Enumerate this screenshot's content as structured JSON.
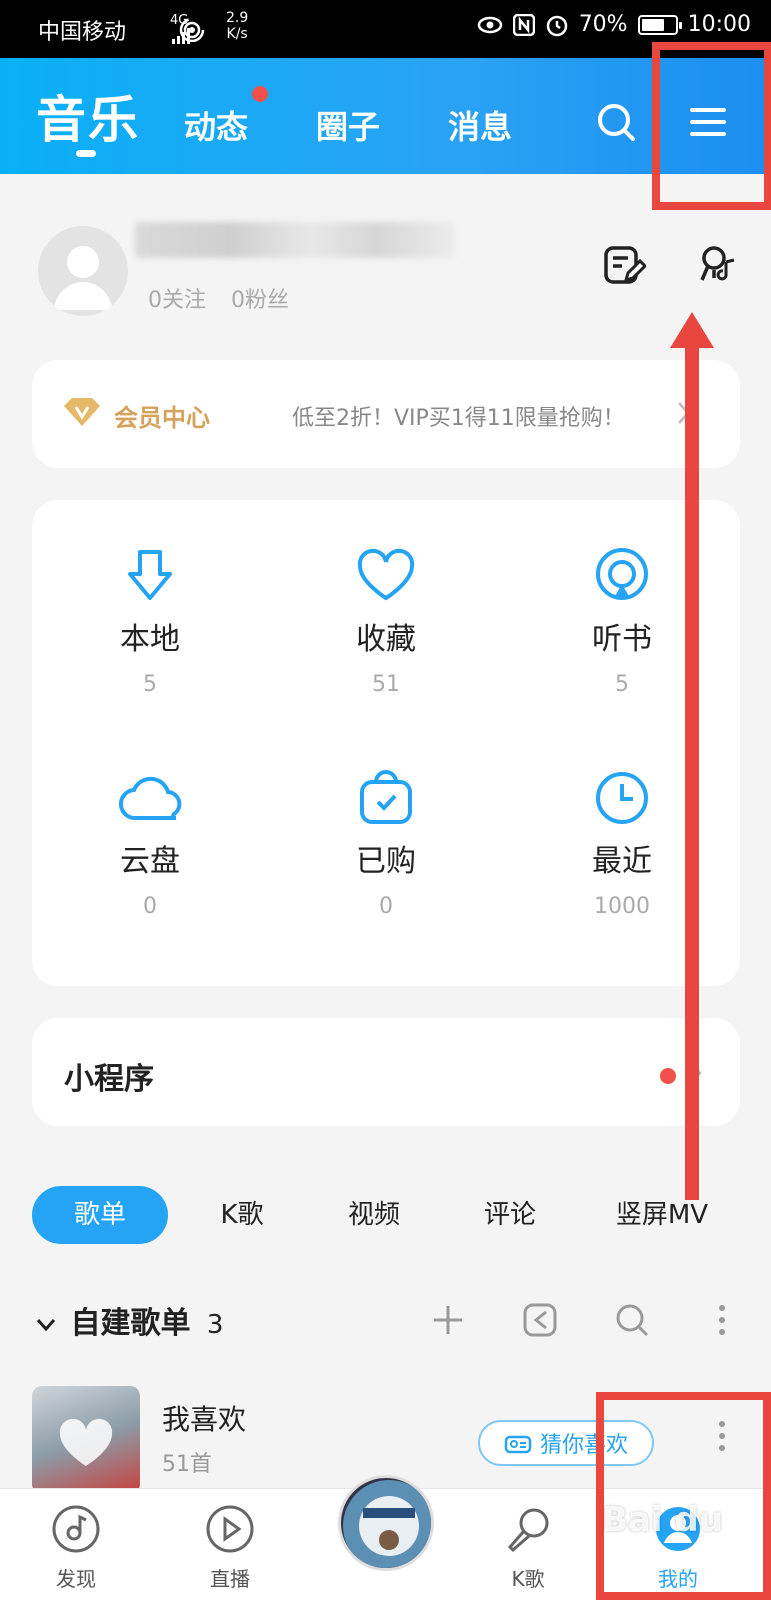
{
  "status_bar": {
    "carrier": "中国移动",
    "network": "4G",
    "speed_value": "2.9",
    "speed_unit": "K/s",
    "battery": "70%",
    "time": "10:00",
    "battery_level": 0.7
  },
  "header": {
    "title": "音乐",
    "tabs": [
      "动态",
      "圈子",
      "消息"
    ],
    "search_icon": "search-icon",
    "menu_icon": "menu-icon"
  },
  "profile": {
    "following_count": "0关注",
    "fans_count": "0粉丝"
  },
  "vip": {
    "title": "会员中心",
    "promo": "低至2折！VIP买1得11限量抢购！"
  },
  "grid": [
    {
      "label": "本地",
      "count": "5",
      "icon": "download-icon"
    },
    {
      "label": "收藏",
      "count": "51",
      "icon": "heart-icon"
    },
    {
      "label": "听书",
      "count": "5",
      "icon": "audiobook-icon"
    },
    {
      "label": "云盘",
      "count": "0",
      "icon": "cloud-icon"
    },
    {
      "label": "已购",
      "count": "0",
      "icon": "purchased-icon"
    },
    {
      "label": "最近",
      "count": "1000",
      "icon": "clock-icon"
    }
  ],
  "mini_program": {
    "title": "小程序"
  },
  "content_tabs": [
    "歌单",
    "K歌",
    "视频",
    "评论",
    "竖屏MV"
  ],
  "playlists": {
    "section_title": "自建歌单",
    "section_count": "3",
    "items": [
      {
        "name": "我喜欢",
        "count": "51首"
      }
    ],
    "guess_label": "猜你喜欢"
  },
  "bottom_nav": {
    "items": [
      "发现",
      "直播",
      "K歌",
      "我的"
    ],
    "active": "我的"
  },
  "colors": {
    "accent": "#25a3f5",
    "highlight": "#e8463e",
    "vip_gold": "#d4a25a"
  }
}
